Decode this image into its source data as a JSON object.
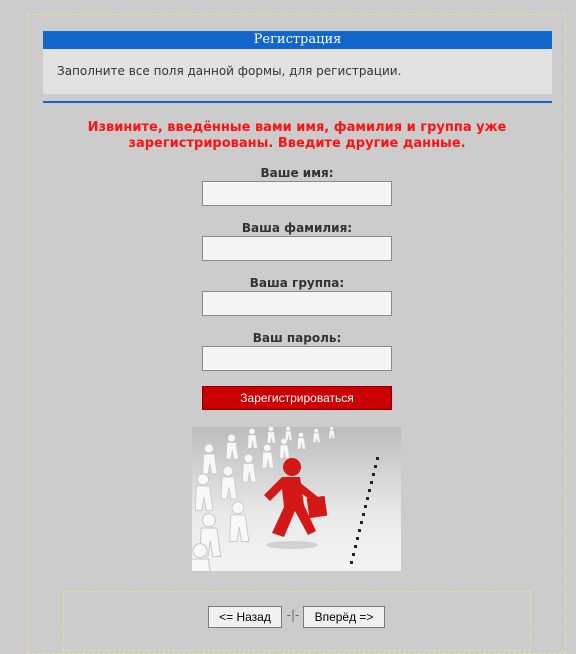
{
  "header": {
    "title": "Регистрация"
  },
  "info": {
    "text": "Заполните все поля данной формы, для регистрации."
  },
  "error": {
    "message": "Извините, введённые вами имя, фамилия и группа уже зарегистрированы. Введите другие данные."
  },
  "form": {
    "name_label": "Ваше имя:",
    "name_value": "",
    "surname_label": "Ваша фамилия:",
    "surname_value": "",
    "group_label": "Ваша группа:",
    "group_value": "",
    "password_label": "Ваш пароль:",
    "password_value": "",
    "submit_label": "Зарегистрироваться"
  },
  "image": {
    "icon": "red-runner-leaving-crowd-illustration"
  },
  "nav": {
    "back_label": "<= Назад",
    "separator": "-|-",
    "forward_label": "Вперёд =>"
  },
  "colors": {
    "accent": "#1166cc",
    "error": "#ff1111",
    "submit": "#cc0000",
    "background": "#cccccc"
  }
}
